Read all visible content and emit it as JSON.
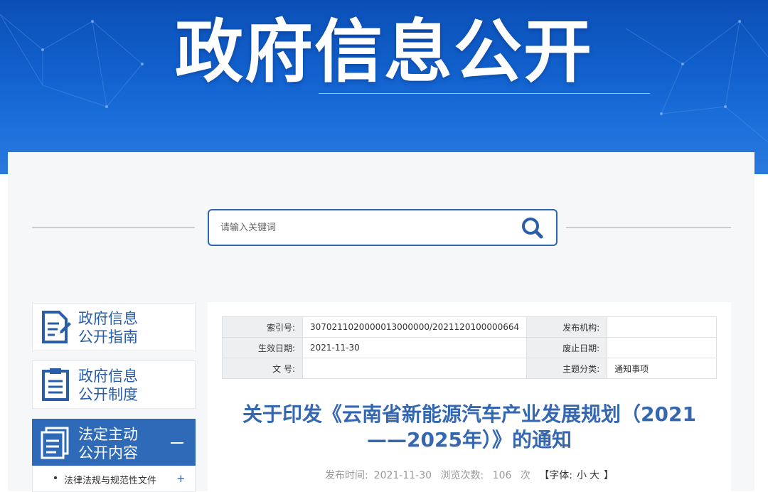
{
  "banner": {
    "title": "政府信息公开"
  },
  "search": {
    "placeholder": "请输入关键词",
    "icon": "search-icon"
  },
  "sidebar": {
    "items": [
      {
        "label_line1": "政府信息",
        "label_line2": "公开指南",
        "icon": "document-edit-icon"
      },
      {
        "label_line1": "政府信息",
        "label_line2": "公开制度",
        "icon": "clipboard-list-icon"
      },
      {
        "label_line1": "法定主动",
        "label_line2": "公开内容",
        "icon": "documents-stack-icon",
        "active": true
      }
    ],
    "sub_items": [
      {
        "label": "法律法规与规范性文件",
        "toggle": "+"
      }
    ]
  },
  "meta_table": {
    "rows": [
      {
        "k1": "索引号:",
        "v1": "3070211020000013000000/2021120100000664",
        "k2": "发布机构:",
        "v2": ""
      },
      {
        "k1": "生效日期:",
        "v1": "2021-11-30",
        "k2": "废止日期:",
        "v2": ""
      },
      {
        "k1": "文 号:",
        "v1": "",
        "k2": "主题分类:",
        "v2": "通知事项"
      }
    ]
  },
  "article": {
    "title_line1": "关于印发《云南省新能源汽车产业发展规划（2021",
    "title_line2": "——2025年）》的通知",
    "publish_label": "发布时间:",
    "publish_date": "2021-11-30",
    "views_label": "浏览次数:",
    "views_count": "106",
    "views_unit": "次",
    "font_label_open": "【字体:",
    "font_small": "小",
    "font_large": "大",
    "font_label_close": "】"
  },
  "colors": {
    "banner_blue": "#1262cf",
    "accent_blue": "#2f6ab8",
    "title_blue": "#3467b0"
  }
}
